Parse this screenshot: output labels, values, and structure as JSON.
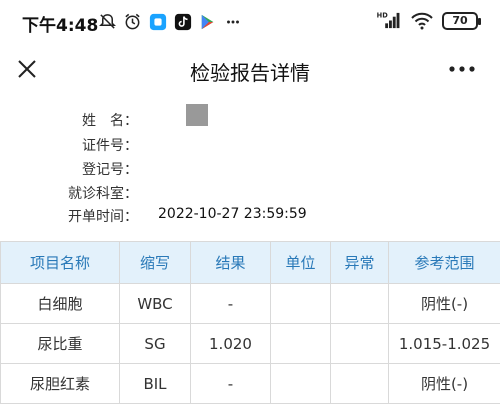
{
  "status_bar": {
    "time": "下午4:48",
    "battery": "70",
    "network_label": "HD"
  },
  "nav": {
    "title": "检验报告详情"
  },
  "patient_info": {
    "fields": [
      {
        "label": "姓　名：",
        "value": ""
      },
      {
        "label": "证件号：",
        "value": ""
      },
      {
        "label": "登记号：",
        "value": ""
      },
      {
        "label": "就诊科室：",
        "value": ""
      },
      {
        "label": "开单时间：",
        "value": "2022-10-27 23:59:59"
      }
    ]
  },
  "results_table": {
    "headers": [
      "项目名称",
      "缩写",
      "结果",
      "单位",
      "异常",
      "参考范围"
    ],
    "rows": [
      [
        "白细胞",
        "WBC",
        "-",
        "",
        "",
        "阴性(-)"
      ],
      [
        "尿比重",
        "SG",
        "1.020",
        "",
        "",
        "1.015-1.025"
      ],
      [
        "尿胆红素",
        "BIL",
        "-",
        "",
        "",
        "阴性(-)"
      ]
    ]
  },
  "colors": {
    "header_bg": "#e3f1fb",
    "header_text": "#2979b8",
    "border": "#d9d9d9"
  }
}
